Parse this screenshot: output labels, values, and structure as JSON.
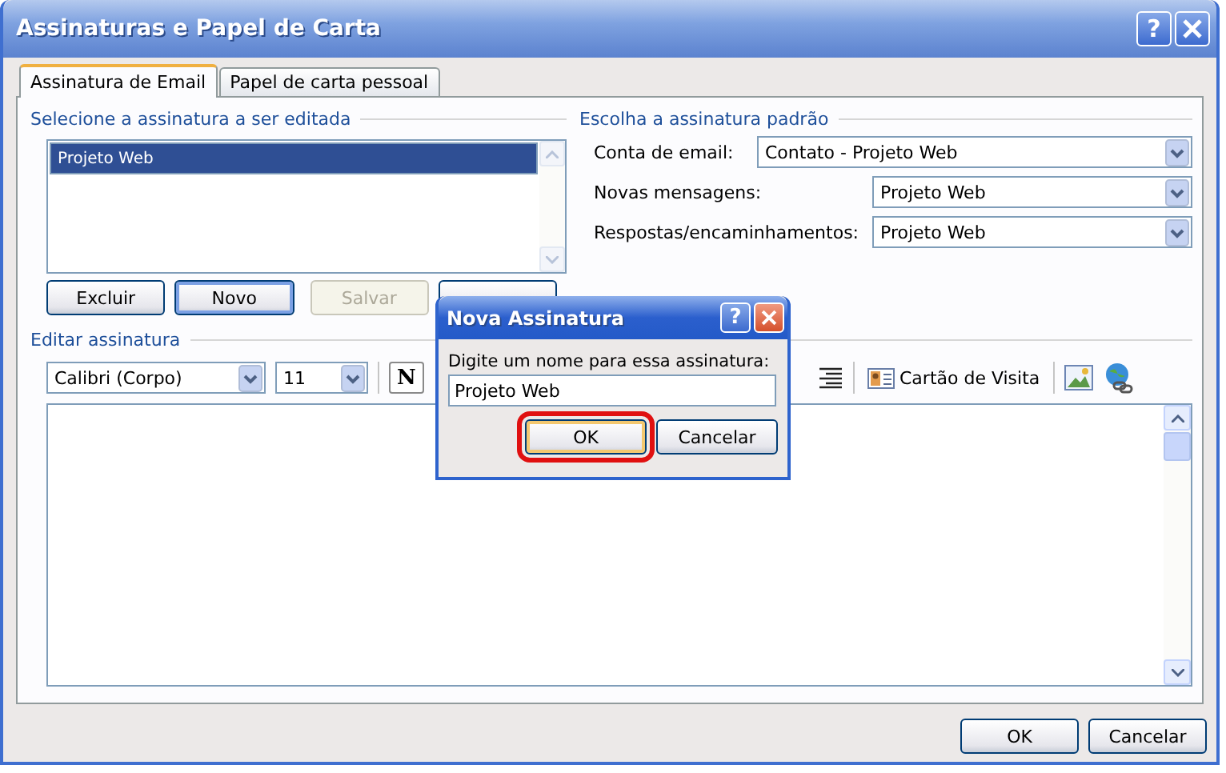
{
  "window": {
    "title": "Assinaturas e Papel de Carta",
    "help": "?"
  },
  "tabs": [
    {
      "label": "Assinatura de Email",
      "selected": true
    },
    {
      "label": "Papel de carta pessoal",
      "selected": false
    }
  ],
  "signatures": {
    "label": "Selecione a assinatura a ser editada",
    "items": [
      {
        "name": "Projeto Web",
        "selected": true
      }
    ],
    "buttons": [
      {
        "label": "Excluir",
        "disabled": false,
        "focused": false
      },
      {
        "label": "Novo",
        "disabled": false,
        "focused": true
      },
      {
        "label": "Salvar",
        "disabled": true,
        "focused": false
      },
      {
        "disabled": false,
        "focused": false
      }
    ]
  },
  "defaults": {
    "label": "Escolha a assinatura padrão",
    "fields": [
      {
        "label": "Conta de email:",
        "value": "Contato - Projeto Web",
        "wide": true
      },
      {
        "label": "Novas mensagens:",
        "value": "Projeto Web",
        "wide": false
      },
      {
        "label": "Respostas/encaminhamentos:",
        "value": "Projeto Web",
        "wide": false
      }
    ]
  },
  "editor": {
    "label": "Editar assinatura",
    "font": "Calibri (Corpo)",
    "size": "11",
    "bold": "N",
    "business_card": "Cartão de Visita"
  },
  "dialog": {
    "title": "Nova Assinatura",
    "help": "?",
    "prompt": "Digite um nome para essa assinatura:",
    "value": "Projeto Web",
    "buttons": [
      {
        "label": "OK",
        "highlighted": true
      },
      {
        "label": "Cancelar",
        "highlighted": false
      }
    ]
  },
  "footer_buttons": [
    "OK",
    "Cancelar"
  ]
}
